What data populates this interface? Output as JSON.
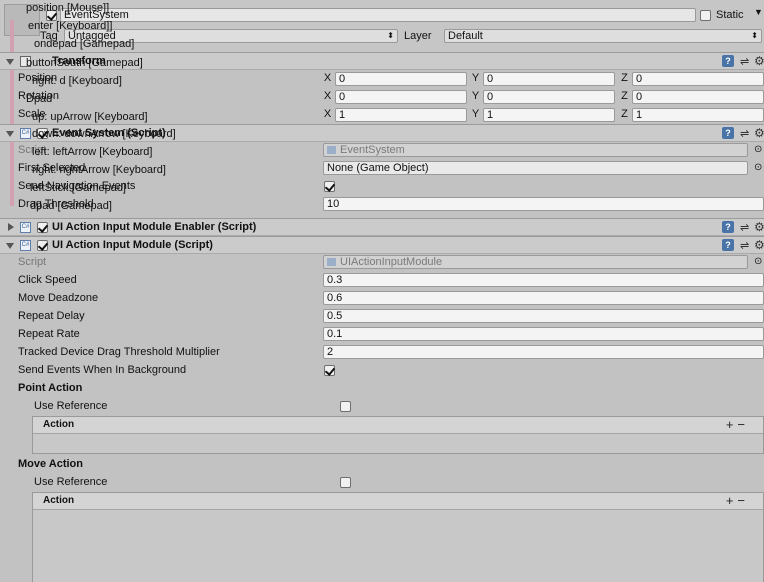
{
  "gameobject": {
    "name": "EventSystem",
    "static_label": "Static",
    "tag_label": "Tag",
    "tag_value": "Untagged",
    "layer_label": "Layer",
    "layer_value": "Default"
  },
  "overlay_text": {
    "a": "position [Mouse]]",
    "b": "enter [Keyboard]]",
    "c": "ondepad [Gamepad]",
    "d": "buttonSouth [Gamepad]",
    "e": "right: d [Keyboard]",
    "f": "Dpad",
    "g": "up: upArrow [Keyboard]",
    "h": "down: downArrow [Keyboard]",
    "i": "left: leftArrow [Keyboard]",
    "j": "right: rightArrow [Keyboard]",
    "k": "leftStick [Gamepad]",
    "l": "dpad [Gamepad]"
  },
  "transform": {
    "title": "Transform",
    "position_label": "Position",
    "rotation_label": "Rotation",
    "scale_label": "Scale",
    "x_label": "X",
    "y_label": "Y",
    "z_label": "Z",
    "position": {
      "x": "0",
      "y": "0",
      "z": "0"
    },
    "rotation": {
      "x": "0",
      "y": "0",
      "z": "0"
    },
    "scale": {
      "x": "1",
      "y": "1",
      "z": "1"
    }
  },
  "event_system": {
    "title": "Event System (Script)",
    "script_label": "Script",
    "script_value": "EventSystem",
    "first_selected_label": "First Selected",
    "first_selected_value": "None (Game Object)",
    "send_navigation_label": "Send Navigation Events",
    "send_navigation_checked": true,
    "drag_threshold_label": "Drag Threshold",
    "drag_threshold_value": "10"
  },
  "enabler": {
    "title": "UI Action Input Module Enabler (Script)",
    "enabled": true
  },
  "module": {
    "title": "UI Action Input Module (Script)",
    "enabled": true,
    "script_label": "Script",
    "script_value": "UIActionInputModule",
    "fields": [
      {
        "label": "Click Speed",
        "value": "0.3"
      },
      {
        "label": "Move Deadzone",
        "value": "0.6"
      },
      {
        "label": "Repeat Delay",
        "value": "0.5"
      },
      {
        "label": "Repeat Rate",
        "value": "0.1"
      },
      {
        "label": "Tracked Device Drag Threshold Multiplier",
        "value": "2"
      }
    ],
    "send_background_label": "Send Events When In Background",
    "send_background_checked": true,
    "point_action": {
      "title": "Point Action",
      "use_reference_label": "Use Reference",
      "use_reference_checked": false,
      "list_header": "Action"
    },
    "move_action": {
      "title": "Move Action",
      "use_reference_label": "Use Reference",
      "use_reference_checked": false,
      "list_header": "Action"
    }
  },
  "icons": {
    "help": "help-icon",
    "preset": "preset-icon",
    "gear": "gear-icon",
    "add": "plus-icon",
    "remove": "minus-icon"
  }
}
